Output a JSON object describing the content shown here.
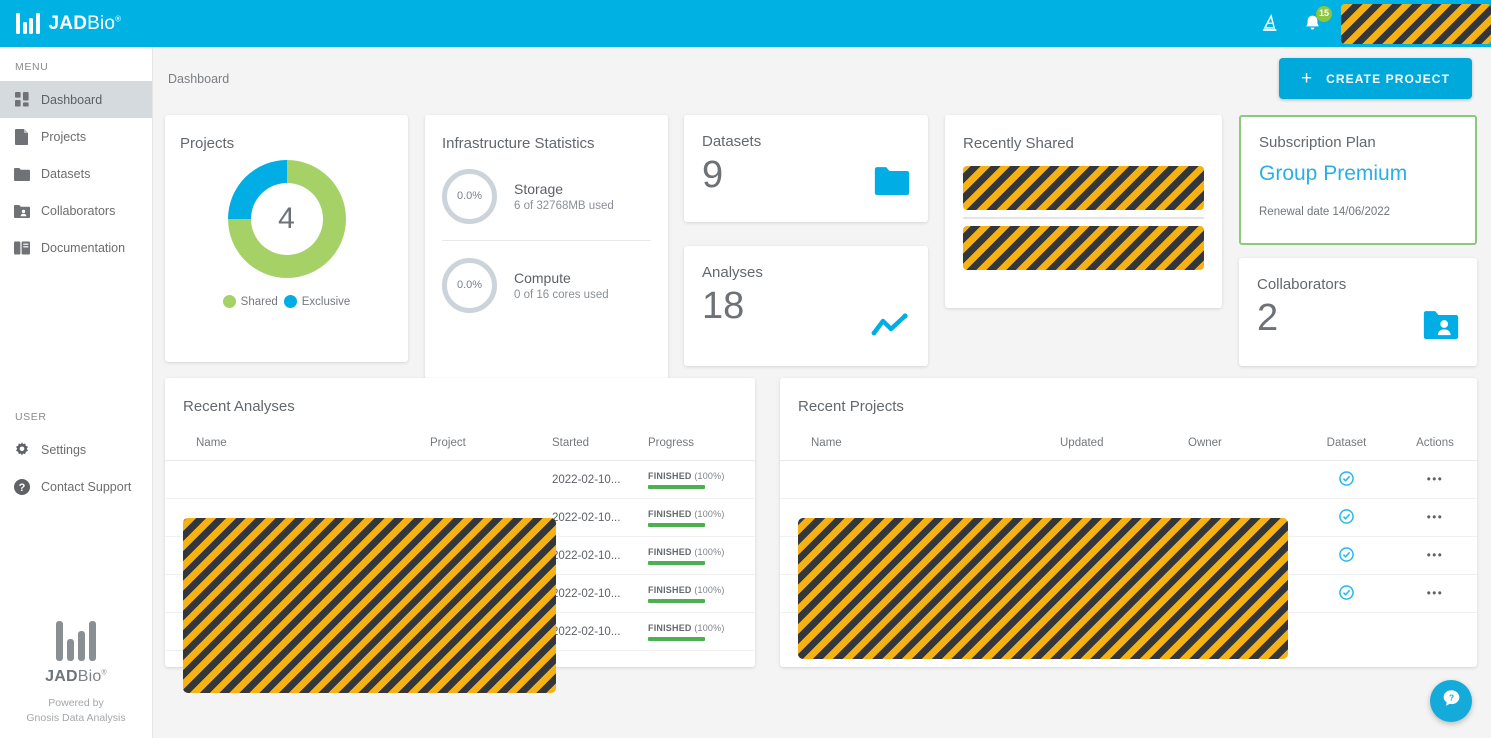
{
  "brand": {
    "name_bold": "JAD",
    "name_light": "Bio",
    "trademark": "®",
    "logo_icon": "jadbio-bars-logo"
  },
  "topbar": {
    "background_color": "#00b2e3",
    "wizard_icon": "wizard-hat-icon",
    "notifications_icon": "bell-icon",
    "notifications_count": "15",
    "badge_color": "#8cc63f",
    "avatar": "[redacted]"
  },
  "sidebar": {
    "menu_label": "MENU",
    "items": [
      {
        "label": "Dashboard",
        "icon": "dashboard-grid-icon",
        "active": true
      },
      {
        "label": "Projects",
        "icon": "file-icon",
        "active": false
      },
      {
        "label": "Datasets",
        "icon": "folder-icon",
        "active": false
      },
      {
        "label": "Collaborators",
        "icon": "folder-user-icon",
        "active": false
      },
      {
        "label": "Documentation",
        "icon": "book-icon",
        "active": false
      }
    ],
    "user_label": "USER",
    "user_items": [
      {
        "label": "Settings",
        "icon": "gear-icon"
      },
      {
        "label": "Contact Support",
        "icon": "question-circle-icon"
      }
    ],
    "footer": {
      "brand_bold": "JAD",
      "brand_light": "Bio",
      "trademark": "®",
      "powered_line1": "Powered by",
      "powered_line2": "Gnosis Data Analysis"
    }
  },
  "main": {
    "breadcrumb": "Dashboard",
    "create_project_label": "CREATE PROJECT",
    "create_project_icon": "plus-icon",
    "create_project_color": "#00a9dc"
  },
  "cards": {
    "projects": {
      "title": "Projects",
      "total": "4",
      "legend": [
        {
          "label": "Shared",
          "color": "#a5d167"
        },
        {
          "label": "Exclusive",
          "color": "#00ade5"
        }
      ]
    },
    "infrastructure": {
      "title": "Infrastructure Statistics",
      "rows": [
        {
          "percent": "0.0%",
          "name": "Storage",
          "detail": "6 of 32768MB used"
        },
        {
          "percent": "0.0%",
          "name": "Compute",
          "detail": "0 of 16 cores used"
        }
      ]
    },
    "datasets": {
      "title": "Datasets",
      "value": "9",
      "icon": "folder-icon",
      "icon_color": "#00ade5"
    },
    "analyses": {
      "title": "Analyses",
      "value": "18",
      "icon": "line-chart-icon",
      "icon_color": "#00ade5"
    },
    "recently_shared": {
      "title": "Recently Shared",
      "items": [
        "[redacted]",
        "[redacted]"
      ]
    },
    "subscription": {
      "title": "Subscription Plan",
      "plan": "Group Premium",
      "renewal": "Renewal date 14/06/2022",
      "border_color": "#8cc97d",
      "plan_color": "#2aafe5"
    },
    "collaborators": {
      "title": "Collaborators",
      "value": "2",
      "icon": "folder-user-icon",
      "icon_color": "#00ade5"
    }
  },
  "recent_analyses": {
    "title": "Recent Analyses",
    "columns": [
      "Name",
      "Project",
      "Started",
      "Progress"
    ],
    "rows": [
      {
        "name": "[redacted]",
        "project": "[redacted]",
        "started": "2022-02-10...",
        "status": "FINISHED",
        "percent": "(100%)",
        "progress": 100
      },
      {
        "name": "[redacted]",
        "project": "[redacted]",
        "started": "2022-02-10...",
        "status": "FINISHED",
        "percent": "(100%)",
        "progress": 100
      },
      {
        "name": "[redacted]",
        "project": "[redacted]",
        "started": "2022-02-10...",
        "status": "FINISHED",
        "percent": "(100%)",
        "progress": 100
      },
      {
        "name": "[redacted]",
        "project": "[redacted]",
        "started": "2022-02-10...",
        "status": "FINISHED",
        "percent": "(100%)",
        "progress": 100
      },
      {
        "name": "[redacted]",
        "project": "[redacted]",
        "started": "2022-02-10...",
        "status": "FINISHED",
        "percent": "(100%)",
        "progress": 100
      }
    ]
  },
  "recent_projects": {
    "title": "Recent Projects",
    "columns": [
      "Name",
      "Updated",
      "Owner",
      "Dataset",
      "Actions"
    ],
    "rows": [
      {
        "name": "[redacted]",
        "updated": "[redacted]",
        "owner": "[redacted]",
        "dataset_icon": "check-circle-icon",
        "actions": "•••"
      },
      {
        "name": "[redacted]",
        "updated": "[redacted]",
        "owner": "[redacted]",
        "dataset_icon": "check-circle-icon",
        "actions": "•••"
      },
      {
        "name": "[redacted]",
        "updated": "[redacted]",
        "owner": "[redacted]",
        "dataset_icon": "check-circle-icon",
        "actions": "•••"
      },
      {
        "name": "[redacted]",
        "updated": "[redacted]",
        "owner": "[redacted]",
        "dataset_icon": "check-circle-icon",
        "actions": "•••"
      }
    ]
  },
  "help": {
    "icon": "help-chat-icon",
    "color": "#14aada"
  },
  "chart_data": {
    "type": "pie",
    "title": "Projects",
    "center_label": "4",
    "categories": [
      "Shared",
      "Exclusive"
    ],
    "values": [
      3,
      1
    ],
    "percentages": [
      75,
      25
    ],
    "colors": [
      "#a5d167",
      "#00ade5"
    ],
    "legend_position": "bottom",
    "donut": true
  }
}
